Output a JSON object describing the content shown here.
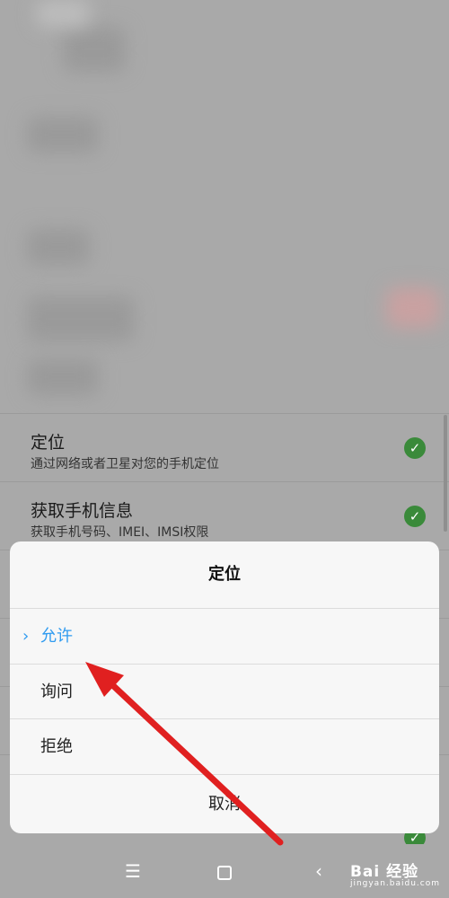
{
  "permissions": [
    {
      "title": "定位",
      "description": "通过网络或者卫星对您的手机定位",
      "granted": true
    },
    {
      "title": "获取手机信息",
      "description": "获取手机号码、IMEI、IMSI权限",
      "granted": true
    }
  ],
  "dialog": {
    "title": "定位",
    "options": [
      {
        "label": "允许",
        "selected": true
      },
      {
        "label": "询问",
        "selected": false
      },
      {
        "label": "拒绝",
        "selected": false
      }
    ],
    "cancel_label": "取消"
  },
  "navbar": {
    "menu_icon": "menu-icon",
    "home_icon": "home-icon",
    "back_icon": "back-icon"
  },
  "watermark": {
    "brand": "Bai 经验",
    "domain": "jingyan.baidu.com"
  },
  "colors": {
    "accent": "#2f9bf0",
    "check_green": "#3a8a3a",
    "arrow_red": "#e02020"
  }
}
